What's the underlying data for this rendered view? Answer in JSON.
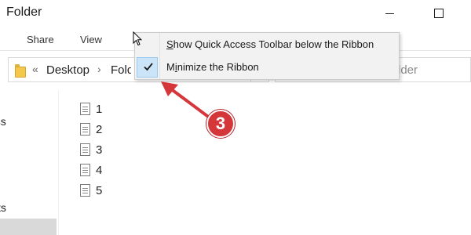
{
  "window": {
    "title": "Folder",
    "minimize_icon": "minimize-icon",
    "maximize_icon": "maximize-icon"
  },
  "ribbon": {
    "tabs": [
      {
        "label": "Share"
      },
      {
        "label": "View"
      }
    ]
  },
  "address": {
    "overflow_chevron": "«",
    "separator": "›",
    "breadcrumbs": [
      "Desktop",
      "Folder"
    ],
    "search_partial_text": "lder"
  },
  "nav_pane": {
    "items": [
      "ess",
      "cts"
    ]
  },
  "files": [
    {
      "name": "1"
    },
    {
      "name": "2"
    },
    {
      "name": "3"
    },
    {
      "name": "4"
    },
    {
      "name": "5"
    }
  ],
  "context_menu": {
    "items": [
      {
        "label": "Show Quick Access Toolbar below the Ribbon",
        "accel": "S",
        "checked": false
      },
      {
        "label": "Minimize the Ribbon",
        "accel": "i",
        "checked": true
      }
    ]
  },
  "annotation": {
    "step_number": "3",
    "color": "#d4363a"
  }
}
